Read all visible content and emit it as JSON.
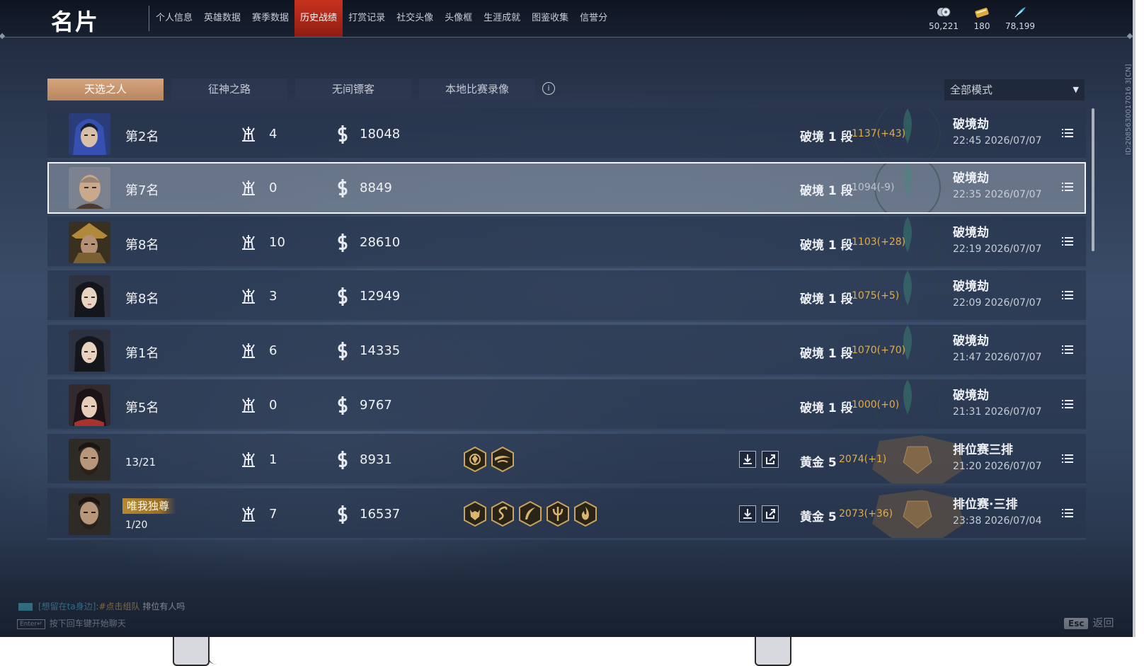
{
  "header": {
    "title": "名片",
    "nav_tabs": [
      {
        "label": "个人信息"
      },
      {
        "label": "英雄数据"
      },
      {
        "label": "赛季数据"
      },
      {
        "label": "历史战绩",
        "active": true
      },
      {
        "label": "打赏记录"
      },
      {
        "label": "社交头像"
      },
      {
        "label": "头像框"
      },
      {
        "label": "生涯成就"
      },
      {
        "label": "图鉴收集"
      },
      {
        "label": "信誉分"
      }
    ],
    "currencies": [
      {
        "icon": "coin-icon",
        "value": "50,221"
      },
      {
        "icon": "ticket-icon",
        "value": "180"
      },
      {
        "icon": "feather-icon",
        "value": "78,199"
      }
    ]
  },
  "subtabs": [
    {
      "label": "天选之人",
      "active": true
    },
    {
      "label": "征神之路"
    },
    {
      "label": "无间镖客"
    },
    {
      "label": "本地比赛录像"
    }
  ],
  "mode_filter": {
    "selected": "全部模式"
  },
  "side_id": "ID:2085630017016 3[CN]",
  "matches": [
    {
      "avatar": "hooded-hero",
      "rank": "第2名",
      "kills": "4",
      "score": "18048",
      "tier": "破境 1 段",
      "tier_score": "1137(+43)",
      "mode": "破境劫",
      "time": "22:45  2026/07/07"
    },
    {
      "avatar": "bald-hero",
      "rank": "第7名",
      "kills": "0",
      "score": "8849",
      "tier": "破境 1 段",
      "tier_score": "1094(-9)",
      "mode": "破境劫",
      "time": "22:35  2026/07/07",
      "selected": true
    },
    {
      "avatar": "armored-hero",
      "rank": "第8名",
      "kills": "10",
      "score": "28610",
      "tier": "破境 1 段",
      "tier_score": "1103(+28)",
      "mode": "破境劫",
      "time": "22:19  2026/07/07"
    },
    {
      "avatar": "maiden-hero",
      "rank": "第8名",
      "kills": "3",
      "score": "12949",
      "tier": "破境 1 段",
      "tier_score": "1075(+5)",
      "mode": "破境劫",
      "time": "22:09  2026/07/07"
    },
    {
      "avatar": "maiden-hero",
      "rank": "第1名",
      "kills": "6",
      "score": "14335",
      "tier": "破境 1 段",
      "tier_score": "1070(+70)",
      "mode": "破境劫",
      "time": "21:47  2026/07/07"
    },
    {
      "avatar": "warrior-woman",
      "rank": "第5名",
      "kills": "0",
      "score": "9767",
      "tier": "破境 1 段",
      "tier_score": "1000(+0)",
      "mode": "破境劫",
      "time": "21:31  2026/07/07"
    },
    {
      "avatar": "bearded-hero",
      "rank": "13/21",
      "kills": "1",
      "score": "8931",
      "badges": [
        "lion-badge-icon",
        "wings-badge-icon"
      ],
      "tier": "黄金 5",
      "tier_score": "2074(+1)",
      "mode": "排位赛三排",
      "time": "21:20  2026/07/07",
      "has_replay": true
    },
    {
      "avatar": "bearded-hero",
      "title_badge": "唯我独尊",
      "rank": "1/20",
      "kills": "7",
      "score": "16537",
      "badges": [
        "demon-badge-icon",
        "dragon-badge-icon",
        "blade-badge-icon",
        "trident-badge-icon",
        "flame-badge-icon"
      ],
      "tier": "黄金 5",
      "tier_score": "2073(+36)",
      "mode": "排位赛·三排",
      "time": "23:38  2026/07/04",
      "has_replay": true
    }
  ],
  "chat": {
    "channel": "[想留在ta身边]",
    "link": ":#点击组队",
    "text": " 排位有人吗",
    "enter_key": "Enter↵",
    "enter_hint": "按下回车键开始聊天"
  },
  "footer": {
    "esc_key": "Esc",
    "back_label": "返回"
  },
  "colors": {
    "accent_red": "#c8321f",
    "accent_gold": "#e1ac4a",
    "subtab_active": "#c99872",
    "chat_channel": "#4cb8d4"
  }
}
